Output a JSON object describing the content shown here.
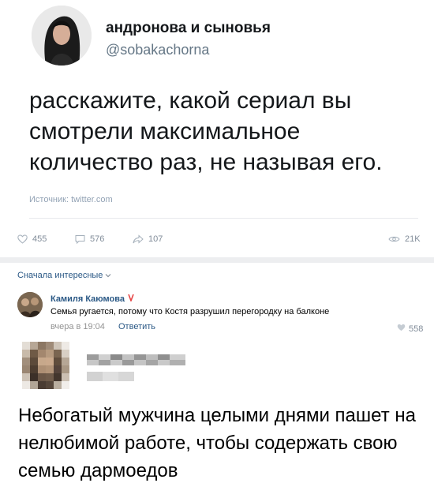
{
  "tweet": {
    "author_name": "андронова и сыновья",
    "author_handle": "@sobakachorna",
    "text": "расскажите, какой сериал вы смотрели максимальное количество раз, не называя его.",
    "source": "Источник: twitter.com"
  },
  "stats": {
    "likes": "455",
    "comments": "576",
    "reposts": "107",
    "views": "21K"
  },
  "comments_section": {
    "sort_label": "Сначала интересные",
    "comment": {
      "author": "Камиля Каюмова",
      "text": "Семья ругается, потому что Костя разрушил перегородку на балконе",
      "time": "вчера в 19:04",
      "reply_label": "Ответить",
      "likes": "558"
    }
  },
  "caption": "Небогатый мужчина целыми днями пашет на нелюбимой работе, чтобы содержать свою семью дармоедов",
  "icons": {
    "like": "heart-icon",
    "comment": "comment-icon",
    "repost": "share-arrow-icon",
    "views": "eye-icon",
    "sort": "chevron-down-icon",
    "verified": "verified-heart-icon"
  },
  "colors": {
    "link": "#2a5885",
    "muted": "#818c99",
    "verified": "#e64646"
  }
}
